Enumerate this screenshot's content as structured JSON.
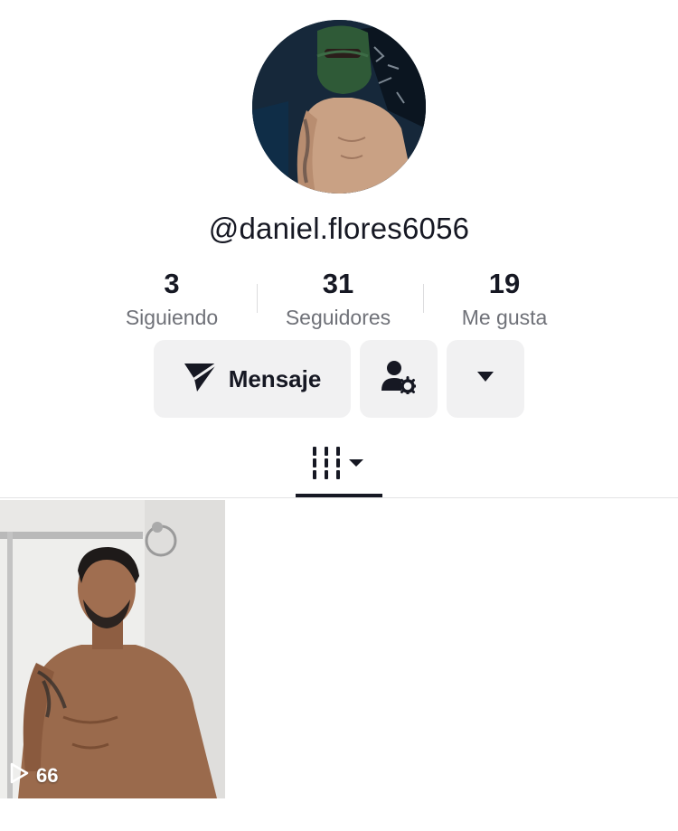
{
  "profile": {
    "username": "@daniel.flores6056",
    "avatar_icon": "avatar-photo"
  },
  "stats": [
    {
      "value": "3",
      "label": "Siguiendo"
    },
    {
      "value": "31",
      "label": "Seguidores"
    },
    {
      "value": "19",
      "label": "Me gusta"
    }
  ],
  "actions": {
    "message_label": "Mensaje",
    "message_icon": "send-icon",
    "friend_icon": "user-settings-icon",
    "more_icon": "caret-down-icon"
  },
  "tabs": {
    "active_icon": "grid-icon"
  },
  "videos": [
    {
      "views": "66",
      "icon": "play-icon"
    }
  ]
}
